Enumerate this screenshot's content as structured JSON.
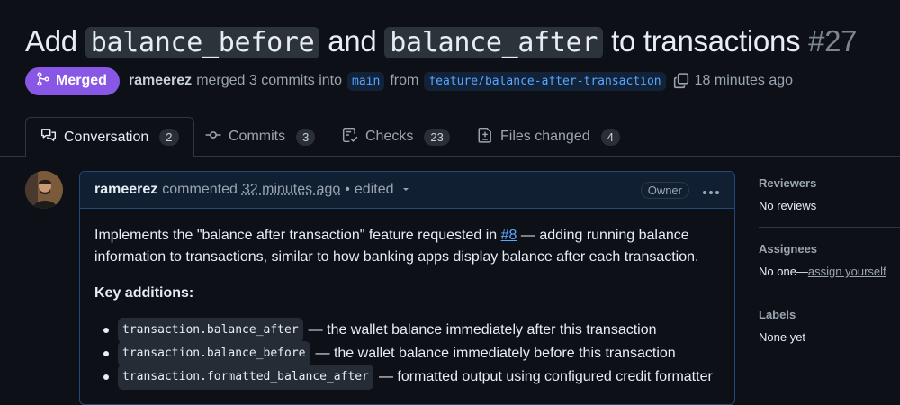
{
  "pr": {
    "title_prefix": "Add",
    "title_code1": "balance_before",
    "title_mid": "and",
    "title_code2": "balance_after",
    "title_suffix": "to transactions",
    "number": "#27"
  },
  "meta": {
    "status": "Merged",
    "author": "rameerez",
    "merged_text": "merged 3 commits into",
    "base_branch": "main",
    "from_text": "from",
    "head_branch": "feature/balance-after-transaction",
    "time": "18 minutes ago"
  },
  "tabs": [
    {
      "label": "Conversation",
      "count": "2",
      "icon": "comment-discussion-icon"
    },
    {
      "label": "Commits",
      "count": "3",
      "icon": "git-commit-icon"
    },
    {
      "label": "Checks",
      "count": "23",
      "icon": "checklist-icon"
    },
    {
      "label": "Files changed",
      "count": "4",
      "icon": "file-diff-icon"
    }
  ],
  "comment": {
    "author": "rameerez",
    "commented": "commented",
    "time": "32 minutes ago",
    "sep": "•",
    "edited": "edited",
    "role": "Owner",
    "more": "•••",
    "intro_before": "Implements the \"balance after transaction\" feature requested in",
    "issue_link": "#8",
    "intro_after": "— adding running balance information to transactions, similar to how banking apps display balance after each transaction.",
    "key_heading": "Key additions:",
    "items": [
      {
        "code": "transaction.balance_after",
        "text": "— the wallet balance immediately after this transaction"
      },
      {
        "code": "transaction.balance_before",
        "text": "— the wallet balance immediately before this transaction"
      },
      {
        "code": "transaction.formatted_balance_after",
        "text": "— formatted output using configured credit formatter"
      }
    ]
  },
  "sidebar": {
    "reviewers_label": "Reviewers",
    "reviewers_value": "No reviews",
    "assignees_label": "Assignees",
    "assignees_value": "No one—",
    "assign_link": "assign yourself",
    "labels_label": "Labels",
    "labels_value": "None yet"
  },
  "colors": {
    "merged": "#8957e5",
    "link": "#58a6ff",
    "background": "#0d1117"
  }
}
